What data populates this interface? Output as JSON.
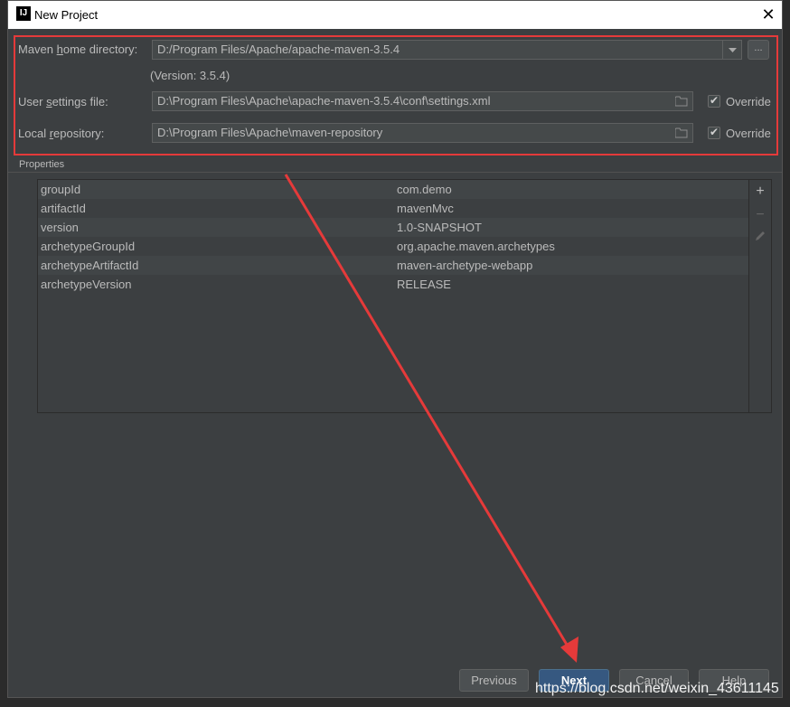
{
  "window": {
    "title": "New Project",
    "app_icon": "IJ"
  },
  "maven": {
    "home_label_pre": "Maven ",
    "home_label_u": "h",
    "home_label_post": "ome directory:",
    "home_value": "D:/Program Files/Apache/apache-maven-3.5.4",
    "browse_label": "...",
    "version_text": "(Version: 3.5.4)",
    "settings_label_pre": "User ",
    "settings_label_u": "s",
    "settings_label_post": "ettings file:",
    "settings_value": "D:\\Program Files\\Apache\\apache-maven-3.5.4\\conf\\settings.xml",
    "settings_override_label": "Override",
    "settings_override_checked": true,
    "repo_label_pre": "Local ",
    "repo_label_u": "r",
    "repo_label_post": "epository:",
    "repo_value": "D:\\Program Files\\Apache\\maven-repository",
    "repo_override_label": "Override",
    "repo_override_checked": true
  },
  "properties": {
    "title": "Properties",
    "rows": [
      {
        "key": "groupId",
        "value": "com.demo"
      },
      {
        "key": "artifactId",
        "value": "mavenMvc"
      },
      {
        "key": "version",
        "value": "1.0-SNAPSHOT"
      },
      {
        "key": "archetypeGroupId",
        "value": "org.apache.maven.archetypes"
      },
      {
        "key": "archetypeArtifactId",
        "value": "maven-archetype-webapp"
      },
      {
        "key": "archetypeVersion",
        "value": "RELEASE"
      }
    ],
    "toolbar": {
      "add": "+",
      "remove": "−"
    }
  },
  "buttons": {
    "previous": "Previous",
    "next": "Next",
    "cancel": "Cancel",
    "help": "Help"
  },
  "watermark": "https://blog.csdn.net/weixin_43611145",
  "colors": {
    "accent_red": "#e53a3a",
    "primary_button": "#365880",
    "panel_bg": "#3c3f41"
  }
}
